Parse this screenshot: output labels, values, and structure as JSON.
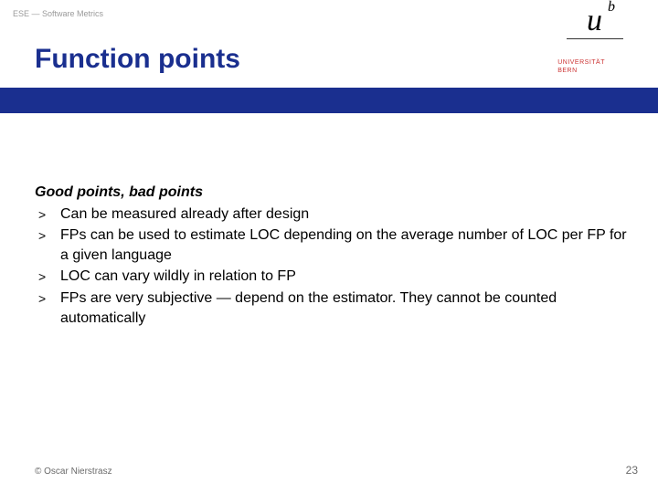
{
  "header": {
    "label": "ESE — Software Metrics"
  },
  "title": "Function points",
  "logo": {
    "u": "u",
    "b": "b",
    "line1": "UNIVERSITÄT",
    "line2": "BERN"
  },
  "content": {
    "subheading": "Good points, bad points",
    "bullets": [
      {
        "marker": ">",
        "text": "Can be measured already after design"
      },
      {
        "marker": ">",
        "text": "FPs can be used to estimate LOC depending on the average number of LOC per FP for a given language"
      },
      {
        "marker": ">",
        "text": "LOC can vary wildly in relation to FP"
      },
      {
        "marker": ">",
        "text": "FPs are very subjective — depend on the estimator. They cannot be counted automatically"
      }
    ]
  },
  "footer": {
    "copyright": "© Oscar Nierstrasz",
    "page": "23"
  }
}
